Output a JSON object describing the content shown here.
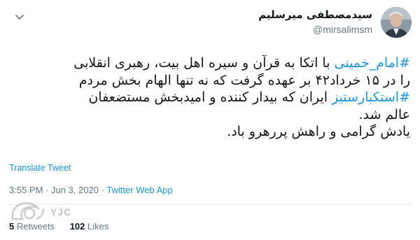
{
  "author": {
    "display_name": "سیدمصطفی میرسلیم",
    "handle": "@mirsalimsm"
  },
  "tweet": {
    "lines": [
      [
        {
          "text": "#امام_خمینی",
          "hashtag": true
        },
        {
          "text": " با اتکا به قرآن و سیره اهل بیت، رهبری انقلابی",
          "hashtag": false
        }
      ],
      [
        {
          "text": "را در ۱۵ خرداد۴۲ بر عهده گرفت که  نه تنها الهام بخش مردم",
          "hashtag": false
        }
      ],
      [
        {
          "text": "#استکبارستیز",
          "hashtag": true
        },
        {
          "text": " ایران که بیدار کننده و امیدبخش مستضعفان",
          "hashtag": false
        }
      ],
      [
        {
          "text": "عالم شد.",
          "hashtag": false
        }
      ],
      [
        {
          "text": "یادش گرامی و راهش پررهرو باد.",
          "hashtag": false
        }
      ]
    ],
    "translate_label": "Translate Tweet"
  },
  "meta": {
    "time": "3:55 PM",
    "date": "Jun 3, 2020",
    "source": "Twitter Web App"
  },
  "stats": {
    "retweets_count": "5",
    "retweets_label": "Retweets",
    "likes_count": "102",
    "likes_label": "Likes"
  },
  "watermark": {
    "text": "YJC"
  },
  "icons": {
    "menu": "chevron-down-icon",
    "avatar": "avatar",
    "watermark": "yjc-logo"
  },
  "colors": {
    "link": "#1b95e0",
    "text": "#14171a",
    "muted": "#657786",
    "divider": "#e6ecf0"
  }
}
